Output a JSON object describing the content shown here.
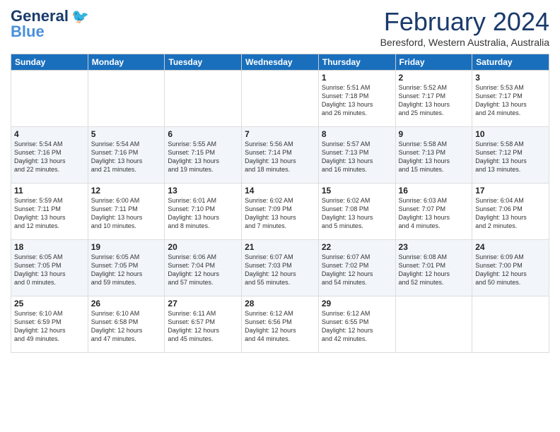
{
  "header": {
    "logo_line1": "General",
    "logo_line2": "Blue",
    "month_year": "February 2024",
    "location": "Beresford, Western Australia, Australia"
  },
  "days_of_week": [
    "Sunday",
    "Monday",
    "Tuesday",
    "Wednesday",
    "Thursday",
    "Friday",
    "Saturday"
  ],
  "weeks": [
    {
      "cells": [
        {
          "day": "",
          "info": ""
        },
        {
          "day": "",
          "info": ""
        },
        {
          "day": "",
          "info": ""
        },
        {
          "day": "",
          "info": ""
        },
        {
          "day": "1",
          "info": "Sunrise: 5:51 AM\nSunset: 7:18 PM\nDaylight: 13 hours\nand 26 minutes."
        },
        {
          "day": "2",
          "info": "Sunrise: 5:52 AM\nSunset: 7:17 PM\nDaylight: 13 hours\nand 25 minutes."
        },
        {
          "day": "3",
          "info": "Sunrise: 5:53 AM\nSunset: 7:17 PM\nDaylight: 13 hours\nand 24 minutes."
        }
      ]
    },
    {
      "cells": [
        {
          "day": "4",
          "info": "Sunrise: 5:54 AM\nSunset: 7:16 PM\nDaylight: 13 hours\nand 22 minutes."
        },
        {
          "day": "5",
          "info": "Sunrise: 5:54 AM\nSunset: 7:16 PM\nDaylight: 13 hours\nand 21 minutes."
        },
        {
          "day": "6",
          "info": "Sunrise: 5:55 AM\nSunset: 7:15 PM\nDaylight: 13 hours\nand 19 minutes."
        },
        {
          "day": "7",
          "info": "Sunrise: 5:56 AM\nSunset: 7:14 PM\nDaylight: 13 hours\nand 18 minutes."
        },
        {
          "day": "8",
          "info": "Sunrise: 5:57 AM\nSunset: 7:13 PM\nDaylight: 13 hours\nand 16 minutes."
        },
        {
          "day": "9",
          "info": "Sunrise: 5:58 AM\nSunset: 7:13 PM\nDaylight: 13 hours\nand 15 minutes."
        },
        {
          "day": "10",
          "info": "Sunrise: 5:58 AM\nSunset: 7:12 PM\nDaylight: 13 hours\nand 13 minutes."
        }
      ]
    },
    {
      "cells": [
        {
          "day": "11",
          "info": "Sunrise: 5:59 AM\nSunset: 7:11 PM\nDaylight: 13 hours\nand 12 minutes."
        },
        {
          "day": "12",
          "info": "Sunrise: 6:00 AM\nSunset: 7:11 PM\nDaylight: 13 hours\nand 10 minutes."
        },
        {
          "day": "13",
          "info": "Sunrise: 6:01 AM\nSunset: 7:10 PM\nDaylight: 13 hours\nand 8 minutes."
        },
        {
          "day": "14",
          "info": "Sunrise: 6:02 AM\nSunset: 7:09 PM\nDaylight: 13 hours\nand 7 minutes."
        },
        {
          "day": "15",
          "info": "Sunrise: 6:02 AM\nSunset: 7:08 PM\nDaylight: 13 hours\nand 5 minutes."
        },
        {
          "day": "16",
          "info": "Sunrise: 6:03 AM\nSunset: 7:07 PM\nDaylight: 13 hours\nand 4 minutes."
        },
        {
          "day": "17",
          "info": "Sunrise: 6:04 AM\nSunset: 7:06 PM\nDaylight: 13 hours\nand 2 minutes."
        }
      ]
    },
    {
      "cells": [
        {
          "day": "18",
          "info": "Sunrise: 6:05 AM\nSunset: 7:05 PM\nDaylight: 13 hours\nand 0 minutes."
        },
        {
          "day": "19",
          "info": "Sunrise: 6:05 AM\nSunset: 7:05 PM\nDaylight: 12 hours\nand 59 minutes."
        },
        {
          "day": "20",
          "info": "Sunrise: 6:06 AM\nSunset: 7:04 PM\nDaylight: 12 hours\nand 57 minutes."
        },
        {
          "day": "21",
          "info": "Sunrise: 6:07 AM\nSunset: 7:03 PM\nDaylight: 12 hours\nand 55 minutes."
        },
        {
          "day": "22",
          "info": "Sunrise: 6:07 AM\nSunset: 7:02 PM\nDaylight: 12 hours\nand 54 minutes."
        },
        {
          "day": "23",
          "info": "Sunrise: 6:08 AM\nSunset: 7:01 PM\nDaylight: 12 hours\nand 52 minutes."
        },
        {
          "day": "24",
          "info": "Sunrise: 6:09 AM\nSunset: 7:00 PM\nDaylight: 12 hours\nand 50 minutes."
        }
      ]
    },
    {
      "cells": [
        {
          "day": "25",
          "info": "Sunrise: 6:10 AM\nSunset: 6:59 PM\nDaylight: 12 hours\nand 49 minutes."
        },
        {
          "day": "26",
          "info": "Sunrise: 6:10 AM\nSunset: 6:58 PM\nDaylight: 12 hours\nand 47 minutes."
        },
        {
          "day": "27",
          "info": "Sunrise: 6:11 AM\nSunset: 6:57 PM\nDaylight: 12 hours\nand 45 minutes."
        },
        {
          "day": "28",
          "info": "Sunrise: 6:12 AM\nSunset: 6:56 PM\nDaylight: 12 hours\nand 44 minutes."
        },
        {
          "day": "29",
          "info": "Sunrise: 6:12 AM\nSunset: 6:55 PM\nDaylight: 12 hours\nand 42 minutes."
        },
        {
          "day": "",
          "info": ""
        },
        {
          "day": "",
          "info": ""
        }
      ]
    }
  ]
}
